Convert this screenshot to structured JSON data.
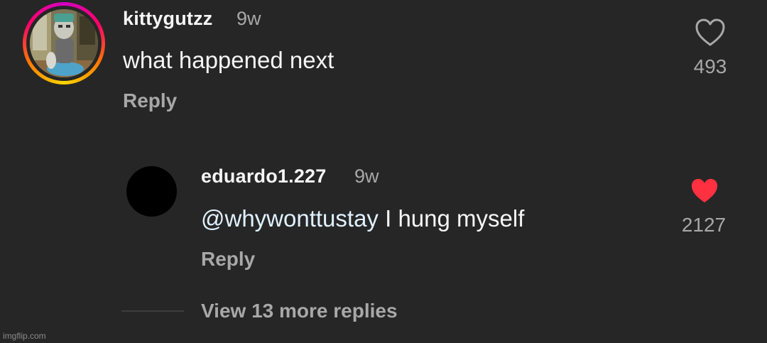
{
  "comment": {
    "username": "kittygutzz",
    "time": "9w",
    "text": "what happened next",
    "reply_label": "Reply",
    "likes": "493",
    "liked": false,
    "avatar": "cartoon-character-avatar"
  },
  "reply": {
    "username": "eduardo1.227",
    "time": "9w",
    "mention": "@whywonttustay",
    "text": " I hung myself",
    "reply_label": "Reply",
    "likes": "2127",
    "liked": true,
    "heart_color": "#ff3040"
  },
  "view_more_label": "View 13 more replies",
  "watermark": "imgflip.com",
  "colors": {
    "background": "#262626",
    "secondary_text": "#a8a8a8",
    "mention": "#e0f1ff",
    "like_red": "#ff3040"
  }
}
